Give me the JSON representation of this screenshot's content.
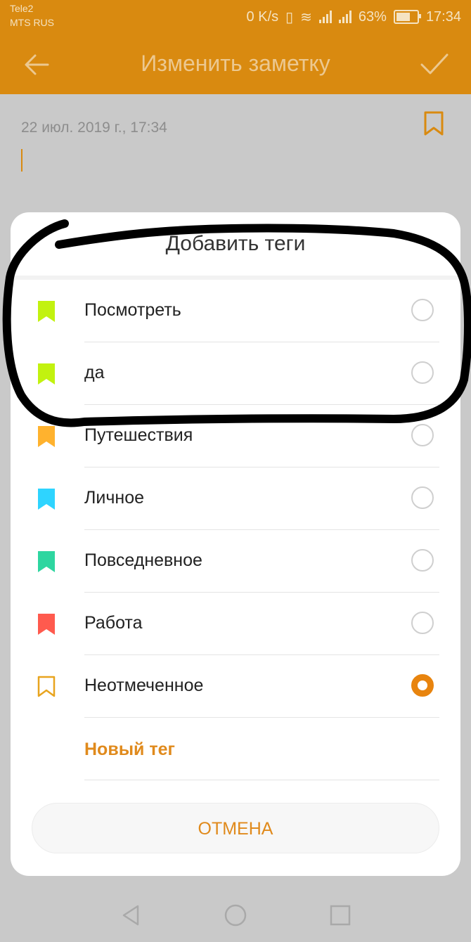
{
  "status_bar": {
    "carrier1": "Tele2",
    "carrier2": "MTS RUS",
    "speed": "0 K/s",
    "battery": "63%",
    "time": "17:34"
  },
  "app_bar": {
    "title": "Изменить заметку"
  },
  "note": {
    "date": "22 июл. 2019 г., 17:34"
  },
  "dialog": {
    "title": "Добавить теги",
    "tags": [
      {
        "label": "Посмотреть",
        "color": "#c2f20f",
        "selected": false
      },
      {
        "label": "да",
        "color": "#c2f20f",
        "selected": false
      },
      {
        "label": "Путешествия",
        "color": "#ffb22e",
        "selected": false
      },
      {
        "label": "Личное",
        "color": "#2ed4ff",
        "selected": false
      },
      {
        "label": "Повседневное",
        "color": "#2ed6a0",
        "selected": false
      },
      {
        "label": "Работа",
        "color": "#ff5a4e",
        "selected": false
      },
      {
        "label": "Неотмеченное",
        "color": "#e8a41e",
        "selected": true,
        "outline": true
      }
    ],
    "new_tag_label": "Новый тег",
    "cancel_label": "ОТМЕНА"
  },
  "colors": {
    "accent": "#d98a10",
    "link": "#e08a1c"
  }
}
